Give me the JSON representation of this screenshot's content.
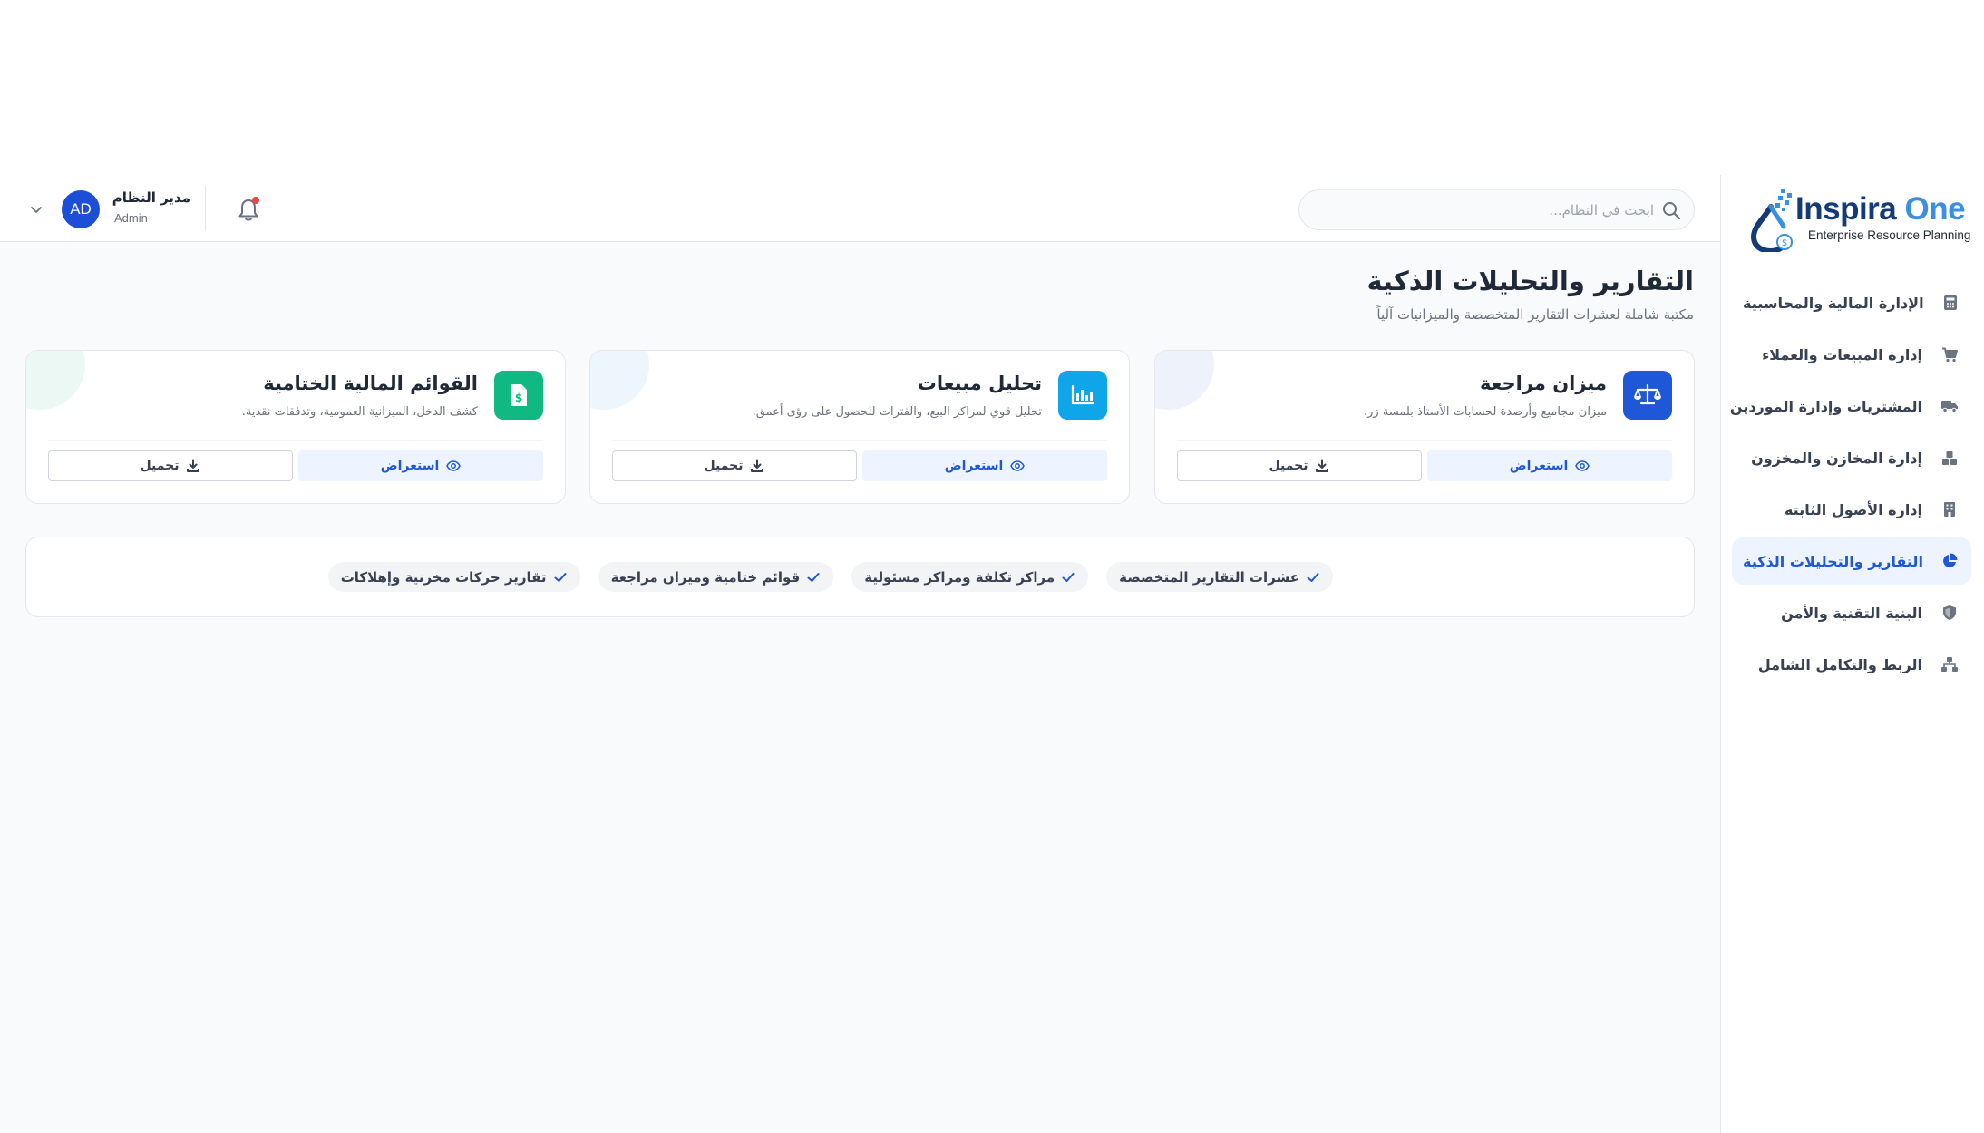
{
  "brand": {
    "name_part1": "Inspira",
    "name_part2": "One",
    "tagline": "Enterprise Resource Planning"
  },
  "sidebar": {
    "items": [
      {
        "label": "الإدارة المالية والمحاسبية",
        "icon": "calculator-icon",
        "active": false
      },
      {
        "label": "إدارة المبيعات والعملاء",
        "icon": "cart-icon",
        "active": false
      },
      {
        "label": "المشتريات وإدارة الموردين",
        "icon": "truck-icon",
        "active": false
      },
      {
        "label": "إدارة المخازن والمخزون",
        "icon": "boxes-icon",
        "active": false
      },
      {
        "label": "إدارة الأصول الثابتة",
        "icon": "building-icon",
        "active": false
      },
      {
        "label": "التقارير والتحليلات الذكية",
        "icon": "pie-chart-icon",
        "active": true
      },
      {
        "label": "البنية التقنية والأمن",
        "icon": "shield-icon",
        "active": false
      },
      {
        "label": "الربط والتكامل الشامل",
        "icon": "network-icon",
        "active": false
      }
    ]
  },
  "header": {
    "search_placeholder": "ابحث في النظام...",
    "user": {
      "name": "مدير النظام",
      "role": "Admin",
      "initials": "AD"
    }
  },
  "page": {
    "title": "التقارير والتحليلات الذكية",
    "subtitle": "مكتبة شاملة لعشرات التقارير المتخصصة والميزانيات آلياً"
  },
  "cards": [
    {
      "title": "ميزان مراجعة",
      "description": "ميزان مجاميع وأرصدة لحسابات الأستاذ بلمسة زر.",
      "icon": "scale-icon",
      "icon_color": "#1f58d6",
      "view_label": "استعراض",
      "download_label": "تحميل"
    },
    {
      "title": "تحليل مبيعات",
      "description": "تحليل قوي لمراكز البيع، والفترات للحصول على رؤى أعمق.",
      "icon": "bar-chart-icon",
      "icon_color": "#0ea5e9",
      "view_label": "استعراض",
      "download_label": "تحميل"
    },
    {
      "title": "القوائم المالية الختامية",
      "description": "كشف الدخل، الميزانية العمومية، وتدفقات نقدية.",
      "icon": "invoice-icon",
      "icon_color": "#10b981",
      "view_label": "استعراض",
      "download_label": "تحميل"
    }
  ],
  "features": [
    "عشرات التقارير المتخصصة",
    "مراكز تكلفة ومراكز مسئولية",
    "قوائم ختامية وميزان مراجعة",
    "تقارير حركات مخزنية وإهلاكات"
  ]
}
